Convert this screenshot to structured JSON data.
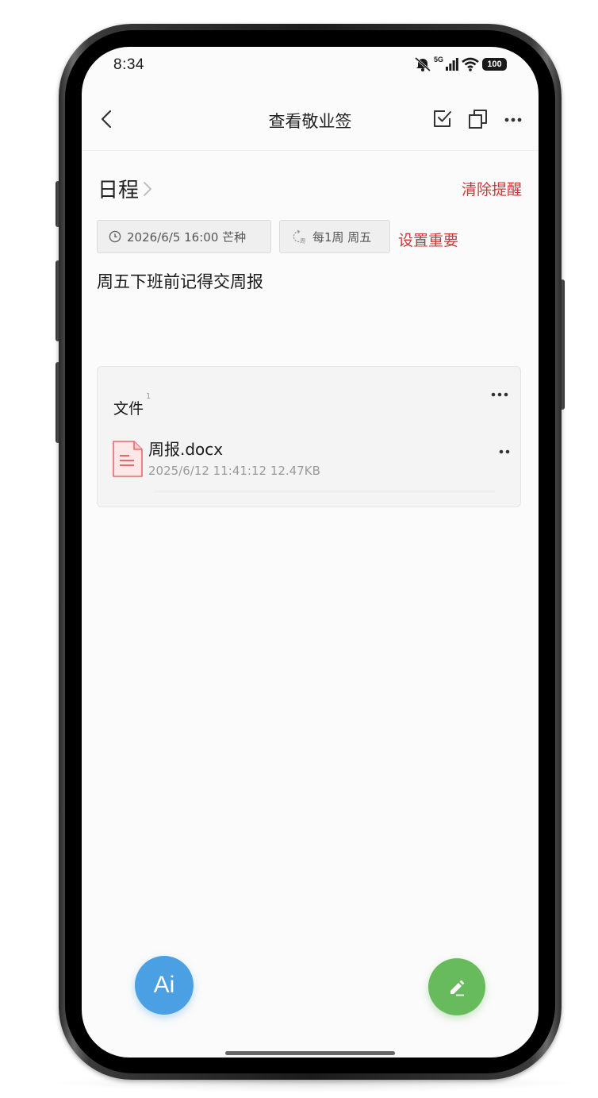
{
  "status_bar": {
    "time": "8:34",
    "network": "5G",
    "battery": "100"
  },
  "header": {
    "title": "查看敬业签"
  },
  "schedule": {
    "title": "日程",
    "clear_reminder": "清除提醒",
    "date_chip": "2026/6/5 16:00 芒种",
    "repeat_chip": "每1周 周五",
    "set_important": "设置重要"
  },
  "note": {
    "content": "周五下班前记得交周报"
  },
  "files": {
    "title": "文件",
    "count": "1",
    "items": [
      {
        "name": "周报.docx",
        "meta": "2025/6/12 11:41:12 12.47KB"
      }
    ]
  },
  "fab": {
    "ai_label": "Ai"
  },
  "colors": {
    "accent_red": "#c8393a",
    "ai_blue": "#4aa0e2",
    "edit_green": "#67bb5d",
    "doc_icon": "#e46b6b"
  }
}
